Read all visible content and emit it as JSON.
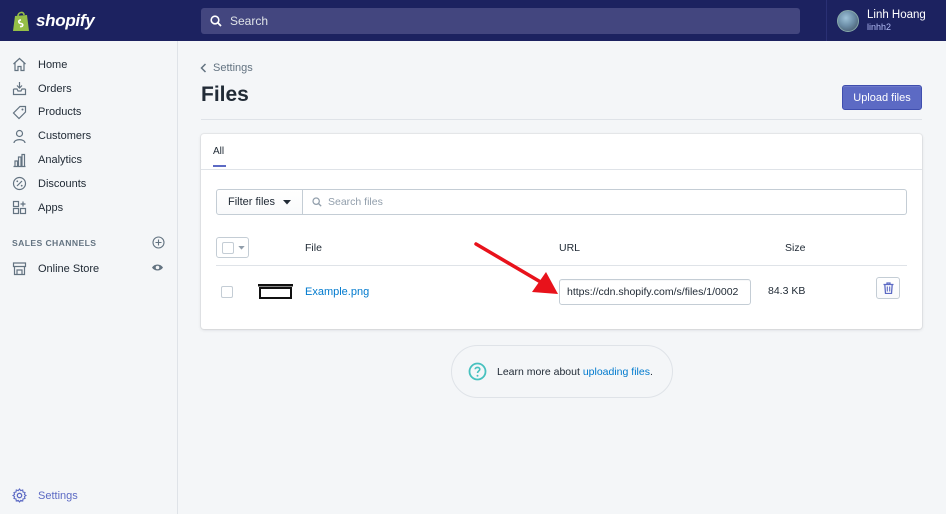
{
  "brand": {
    "name": "shopify",
    "accent": "#5c6ac4",
    "topbar": "#1c2260"
  },
  "search": {
    "placeholder": "Search"
  },
  "user": {
    "name": "Linh Hoang",
    "handle": "linhh2"
  },
  "sidebar": {
    "items": [
      {
        "label": "Home",
        "icon": "home-icon"
      },
      {
        "label": "Orders",
        "icon": "orders-icon"
      },
      {
        "label": "Products",
        "icon": "tag-icon"
      },
      {
        "label": "Customers",
        "icon": "person-icon"
      },
      {
        "label": "Analytics",
        "icon": "bar-chart-icon"
      },
      {
        "label": "Discounts",
        "icon": "discount-icon"
      },
      {
        "label": "Apps",
        "icon": "apps-icon"
      }
    ],
    "channels_title": "SALES CHANNELS",
    "online_store": "Online Store",
    "settings": "Settings"
  },
  "page": {
    "breadcrumb": "Settings",
    "title": "Files",
    "upload_label": "Upload files"
  },
  "tabs": {
    "all": "All"
  },
  "filter": {
    "button": "Filter files",
    "search_placeholder": "Search files"
  },
  "table": {
    "headers": {
      "file": "File",
      "url": "URL",
      "size": "Size"
    },
    "rows": [
      {
        "file": "Example.png",
        "url": "https://cdn.shopify.com/s/files/1/0002",
        "size": "84.3 KB"
      }
    ]
  },
  "help": {
    "prefix": "Learn more about ",
    "link": "uploading files",
    "suffix": "."
  }
}
